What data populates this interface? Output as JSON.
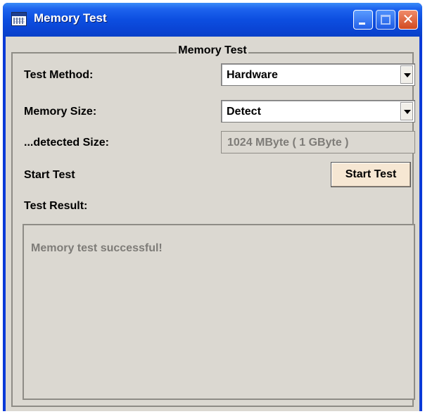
{
  "window": {
    "title": "Memory Test",
    "icon": "memory-test-app-icon"
  },
  "titlebar_buttons": {
    "minimize": "minimize-icon",
    "maximize": "maximize-icon",
    "close": "close-icon",
    "close_glyph": "✕"
  },
  "group": {
    "title": "Memory Test"
  },
  "fields": {
    "test_method": {
      "label": "Test Method:",
      "value": "Hardware"
    },
    "memory_size": {
      "label": "Memory Size:",
      "value": "Detect"
    },
    "detected_size": {
      "label": "...detected Size:",
      "value": "1024 MByte ( 1 GByte )"
    }
  },
  "start": {
    "label": "Start Test",
    "button": "Start Test"
  },
  "result": {
    "label": "Test Result:",
    "text": "Memory test successful!"
  }
}
